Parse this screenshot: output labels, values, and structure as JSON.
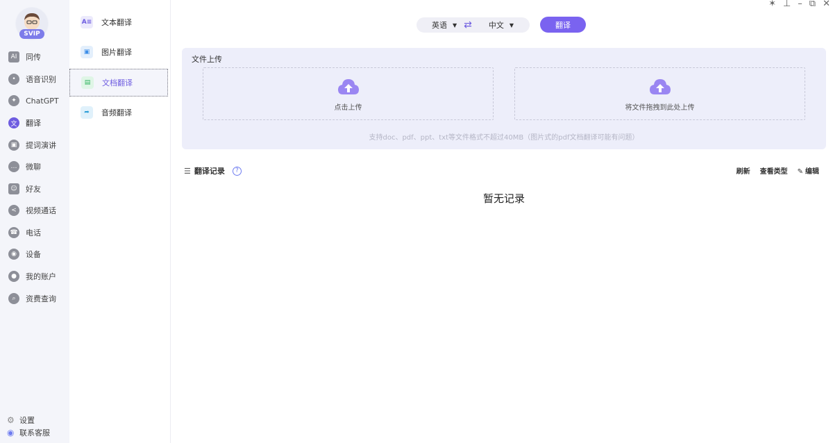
{
  "window_controls": [
    "✶",
    "⊥",
    "–",
    "⧉",
    "✕"
  ],
  "profile": {
    "badge": "SVIP"
  },
  "nav": [
    {
      "label": "同传",
      "icon": "ai-subtitle-icon",
      "glyph": "AI"
    },
    {
      "label": "语音识别",
      "icon": "microphone-icon",
      "glyph": "•"
    },
    {
      "label": "ChatGPT",
      "icon": "chatgpt-icon",
      "glyph": "✦"
    },
    {
      "label": "翻译",
      "icon": "translate-icon",
      "glyph": "文"
    },
    {
      "label": "提词演讲",
      "icon": "teleprompter-icon",
      "glyph": "▣"
    },
    {
      "label": "微聊",
      "icon": "chat-bubble-icon",
      "glyph": "…"
    },
    {
      "label": "好友",
      "icon": "contacts-icon",
      "glyph": "☺"
    },
    {
      "label": "视频通话",
      "icon": "share-icon",
      "glyph": "<"
    },
    {
      "label": "电话",
      "icon": "phone-icon",
      "glyph": "☎"
    },
    {
      "label": "设备",
      "icon": "device-icon",
      "glyph": "◉"
    },
    {
      "label": "我的账户",
      "icon": "account-icon",
      "glyph": "●"
    },
    {
      "label": "资费查询",
      "icon": "search-icon",
      "glyph": "⌕"
    }
  ],
  "bottom_nav": [
    {
      "label": "设置",
      "icon": "gear-icon"
    },
    {
      "label": "联系客服",
      "icon": "support-icon"
    }
  ],
  "sub_nav": [
    {
      "label": "文本翻译",
      "icon": "text-translate-icon"
    },
    {
      "label": "图片翻译",
      "icon": "image-translate-icon"
    },
    {
      "label": "文档翻译",
      "icon": "document-translate-icon"
    },
    {
      "label": "音频翻译",
      "icon": "audio-translate-icon"
    }
  ],
  "language": {
    "source": "英语",
    "target": "中文",
    "swap_glyph": "⇄"
  },
  "translate_button": "翻译",
  "upload": {
    "title": "文件上传",
    "click_upload": "点击上传",
    "drag_upload": "将文件拖拽到此处上传",
    "hint": "支持doc、pdf、ppt、txt等文件格式不超过40MB（图片式的pdf文档翻译可能有问题）"
  },
  "records": {
    "title": "翻译记录",
    "help": "?",
    "refresh": "刷新",
    "view_type": "查看类型",
    "edit": "编辑",
    "empty": "暂无记录"
  },
  "colors": {
    "accent": "#7a63f0",
    "panel": "#edeefa",
    "nav_bg": "#f4f5fa"
  }
}
